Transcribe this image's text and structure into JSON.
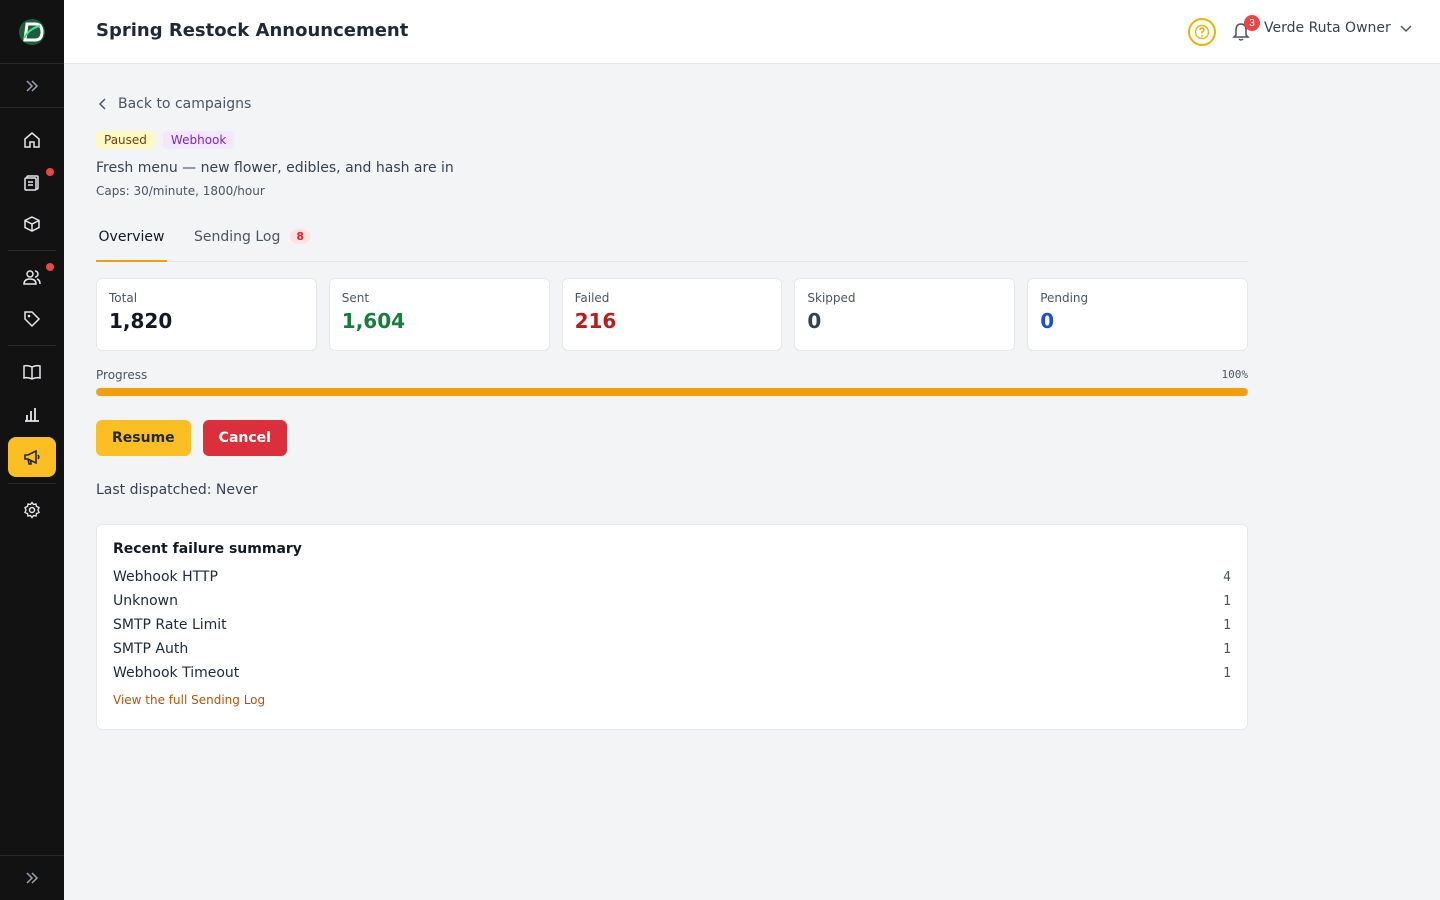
{
  "header": {
    "title": "Spring Restock Announcement",
    "notification_count": "3",
    "user_name": "Verde Ruta Owner"
  },
  "sidebar": {
    "items": [
      {
        "name": "home-icon"
      },
      {
        "name": "clipboard-icon",
        "dot": true
      },
      {
        "name": "box-icon"
      },
      {
        "name": "users-icon",
        "dot": true
      },
      {
        "name": "tag-icon"
      },
      {
        "name": "map-icon"
      },
      {
        "name": "bar-chart-icon"
      },
      {
        "name": "megaphone-icon",
        "active": true
      },
      {
        "name": "gear-icon"
      }
    ]
  },
  "campaign": {
    "back_label": "Back to campaigns",
    "status_badge": "Paused",
    "channel_badge": "Webhook",
    "description": "Fresh menu — new flower, edibles, and hash are in",
    "caps": "Caps: 30/minute, 1800/hour"
  },
  "tabs": {
    "overview": "Overview",
    "sending_log": "Sending Log",
    "sending_log_count": "8"
  },
  "stats": {
    "total_label": "Total",
    "total": "1,820",
    "sent_label": "Sent",
    "sent": "1,604",
    "failed_label": "Failed",
    "failed": "216",
    "skipped_label": "Skipped",
    "skipped": "0",
    "pending_label": "Pending",
    "pending": "0"
  },
  "progress": {
    "label": "Progress",
    "percent_text": "100%",
    "fraction": 1.0
  },
  "actions": {
    "resume": "Resume",
    "cancel": "Cancel"
  },
  "dispatch": {
    "label": "Last dispatched:",
    "value": "Never"
  },
  "failures": {
    "title": "Recent failure summary",
    "rows": [
      {
        "reason": "Webhook HTTP",
        "count": "4"
      },
      {
        "reason": "Unknown",
        "count": "1"
      },
      {
        "reason": "SMTP Rate Limit",
        "count": "1"
      },
      {
        "reason": "SMTP Auth",
        "count": "1"
      },
      {
        "reason": "Webhook Timeout",
        "count": "1"
      }
    ],
    "view_log_link": "View the full Sending Log"
  },
  "colors": {
    "accent": "#f59e0b",
    "sidebar_bg": "#121212",
    "danger": "#dc2f3c",
    "success": "#15803d",
    "info": "#1d4ed8"
  }
}
